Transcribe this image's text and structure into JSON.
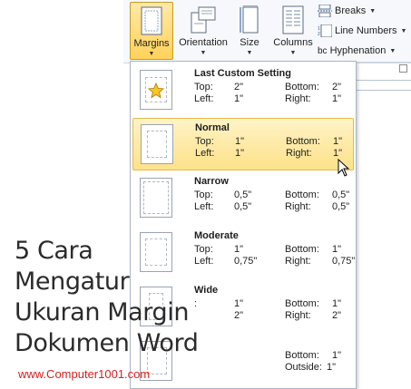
{
  "ribbon": {
    "margins": "Margins",
    "orientation": "Orientation",
    "size": "Size",
    "columns": "Columns",
    "breaks": "Breaks",
    "line_numbers": "Line Numbers",
    "hyphenation": "Hyphenation",
    "hyphenation_prefix": "bc"
  },
  "gallery": {
    "items": [
      {
        "title": "Last Custom Setting",
        "l1": "Top:",
        "v1": "2\"",
        "l2": "Bottom:",
        "v2": "2\"",
        "l3": "Left:",
        "v3": "1\"",
        "l4": "Right:",
        "v4": "1\""
      },
      {
        "title": "Normal",
        "l1": "Top:",
        "v1": "1\"",
        "l2": "Bottom:",
        "v2": "1\"",
        "l3": "Left:",
        "v3": "1\"",
        "l4": "Right:",
        "v4": "1\""
      },
      {
        "title": "Narrow",
        "l1": "Top:",
        "v1": "0,5\"",
        "l2": "Bottom:",
        "v2": "0,5\"",
        "l3": "Left:",
        "v3": "0,5\"",
        "l4": "Right:",
        "v4": "0,5\""
      },
      {
        "title": "Moderate",
        "l1": "Top:",
        "v1": "1\"",
        "l2": "Bottom:",
        "v2": "1\"",
        "l3": "Left:",
        "v3": "0,75\"",
        "l4": "Right:",
        "v4": "0,75\""
      },
      {
        "title": "Wide",
        "l1": ":",
        "v1": "1\"",
        "l2": "Bottom:",
        "v2": "1\"",
        "l3": "",
        "v3": "2\"",
        "l4": "Right:",
        "v4": "2\""
      },
      {
        "title": "",
        "l2": "Bottom:",
        "v2": "1\"",
        "l4": "Outside:",
        "v4": "1\""
      }
    ]
  },
  "overlay": {
    "headline": [
      "5 Cara",
      "Mengatur",
      "Ukuran Margin",
      "Dokumen Word"
    ],
    "site": "www.Computer1001.com"
  }
}
